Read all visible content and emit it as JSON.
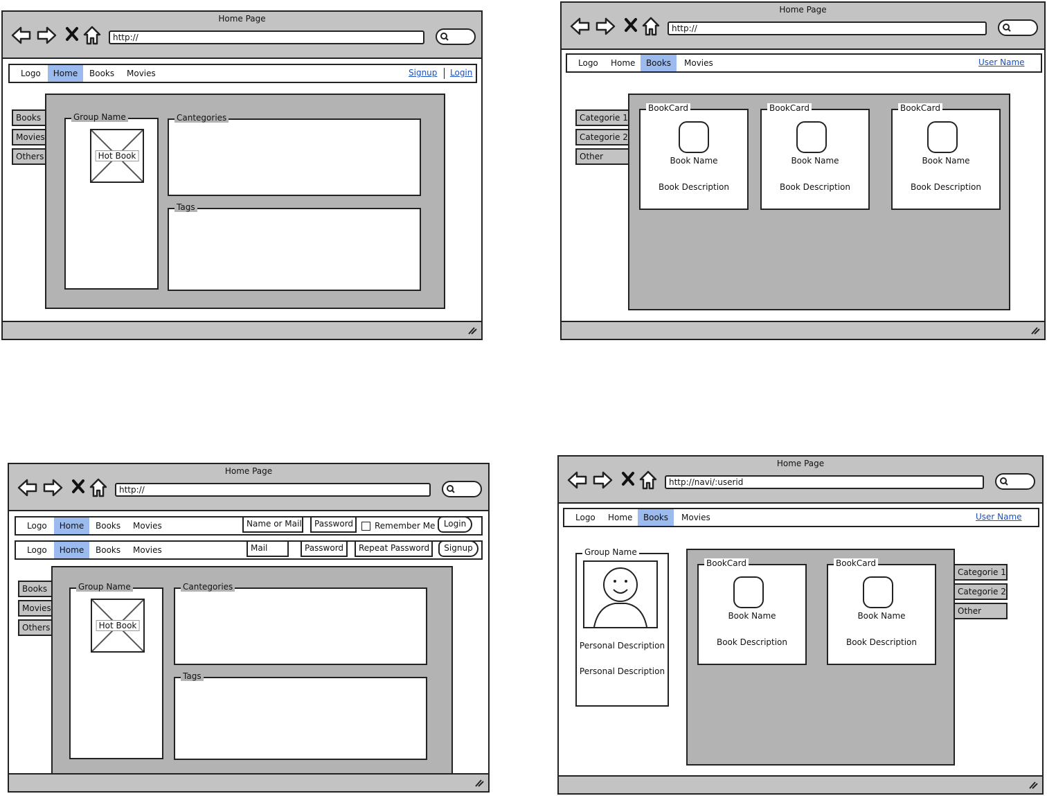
{
  "wireframes": [
    {
      "window_title": "Home Page",
      "url": "http://",
      "menu": [
        "Logo",
        "Home",
        "Books",
        "Movies"
      ],
      "selected": "Home",
      "links": [
        "Signup",
        "Login"
      ],
      "side_tabs": [
        "Books",
        "Movies",
        "Others"
      ],
      "group_label": "Group Name",
      "image_label": "Hot Book",
      "categories_label": "Cantegories",
      "tags_label": "Tags"
    },
    {
      "window_title": "Home Page",
      "url": "http://",
      "menu": [
        "Logo",
        "Home",
        "Books",
        "Movies"
      ],
      "selected": "Books",
      "user_link": "User Name",
      "side_tabs": [
        "Categorie 1",
        "Categorie 2",
        "Other"
      ],
      "cards": [
        {
          "label": "BookCard",
          "name": "Book Name",
          "description": "Book Description"
        },
        {
          "label": "BookCard",
          "name": "Book Name",
          "description": "Book Description"
        },
        {
          "label": "BookCard",
          "name": "Book Name",
          "description": "Book Description"
        }
      ]
    },
    {
      "window_title": "Home Page",
      "url": "http://",
      "login_bar": {
        "menu": [
          "Logo",
          "Home",
          "Books",
          "Movies"
        ],
        "fields": [
          "Name or Mail",
          "Password"
        ],
        "remember": "Remember Me",
        "button": "Login"
      },
      "signup_bar": {
        "menu": [
          "Logo",
          "Home",
          "Books",
          "Movies"
        ],
        "fields": [
          "Mail",
          "Password",
          "Repeat Password"
        ],
        "button": "Signup"
      },
      "side_tabs": [
        "Books",
        "Movies",
        "Others"
      ],
      "group_label": "Group Name",
      "image_label": "Hot Book",
      "categories_label": "Cantegories",
      "tags_label": "Tags"
    },
    {
      "window_title": "Home Page",
      "url": "http://navi/:userid",
      "menu": [
        "Logo",
        "Home",
        "Books",
        "Movies"
      ],
      "selected": "Books",
      "user_link": "User Name",
      "profile": {
        "label": "Group Name",
        "lines": [
          "Personal Description",
          "Personal Description"
        ]
      },
      "cards": [
        {
          "label": "BookCard",
          "name": "Book Name",
          "description": "Book Description"
        },
        {
          "label": "BookCard",
          "name": "Book Name",
          "description": "Book Description"
        }
      ],
      "side_tabs": [
        "Categorie 1",
        "Categorie 2",
        "Other"
      ]
    }
  ]
}
